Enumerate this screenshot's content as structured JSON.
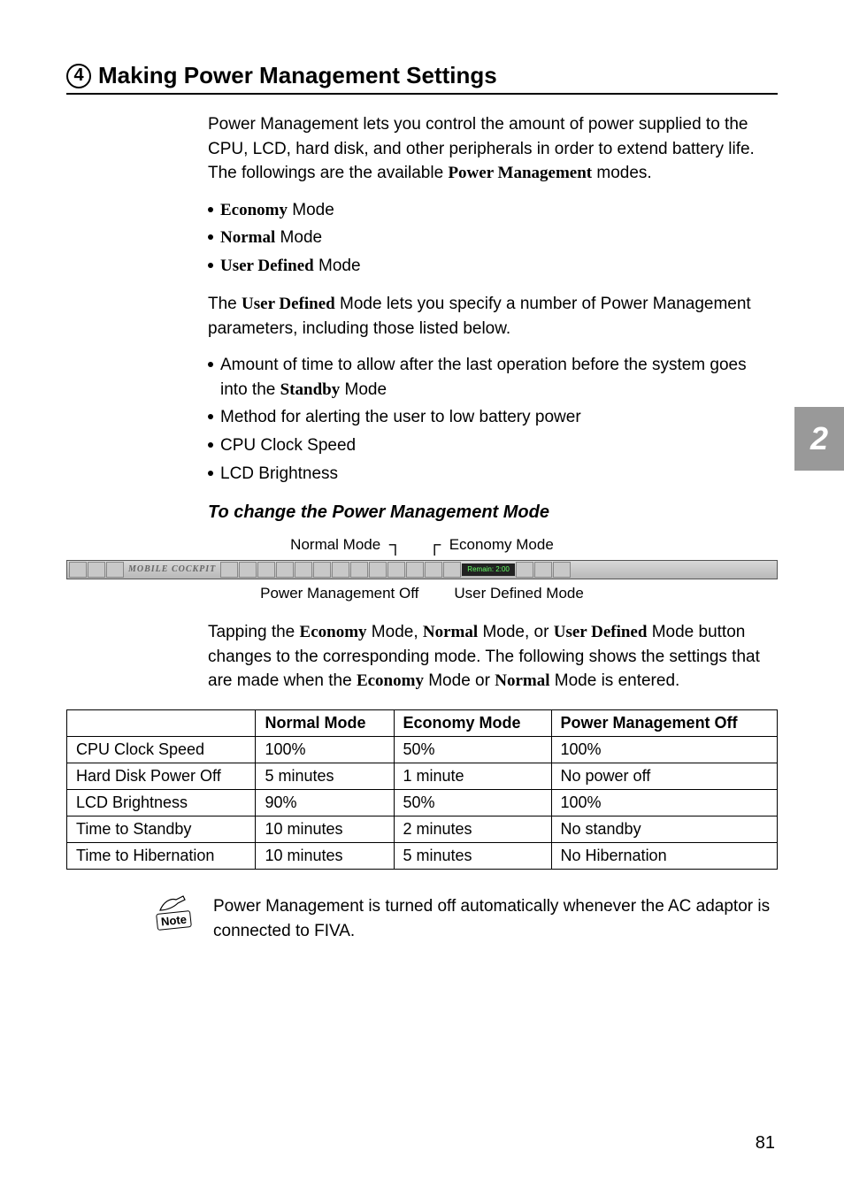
{
  "heading": {
    "num": "4",
    "title": "Making Power Management Settings"
  },
  "intro": {
    "pre": "Power Management lets you control the amount of power supplied to the CPU, LCD, hard disk, and other peripherals in order to extend battery life. The followings are the available ",
    "bold": "Power Management",
    "post": " modes."
  },
  "modes_list": [
    {
      "bold": "Economy",
      "rest": " Mode"
    },
    {
      "bold": "Normal",
      "rest": " Mode"
    },
    {
      "bold": "User Defined",
      "rest": " Mode"
    }
  ],
  "ud_intro": {
    "pre": "The ",
    "bold": "User Defined",
    "post": " Mode lets you specify a number of Power Management parameters, including those listed below."
  },
  "ud_list": {
    "i1a": "Amount of time to allow after the last operation before the system goes into the ",
    "i1b": "Standby",
    "i1c": " Mode",
    "i2": "Method for alerting the user to low battery power",
    "i3": "CPU Clock Speed",
    "i4": "LCD Brightness"
  },
  "sub_heading": "To change the Power Management Mode",
  "labels": {
    "normal": "Normal Mode",
    "economy": "Economy Mode",
    "pmoff": "Power Management Off",
    "userdef": "User Defined Mode"
  },
  "toolbar": {
    "brand": "MOBILE COCKPIT",
    "remain": "Remain: 2:00"
  },
  "tap_para": {
    "t1": "Tapping the ",
    "b1": "Economy",
    "t2": " Mode, ",
    "b2": "Normal",
    "t3": " Mode, or ",
    "b3": "User Defined",
    "t4": " Mode button changes to the corresponding mode. The following shows the settings that are made when the ",
    "b4": "Economy",
    "t5": " Mode or ",
    "b5": "Normal",
    "t6": " Mode is entered."
  },
  "table": {
    "headers": [
      "",
      "Normal Mode",
      "Economy Mode",
      "Power Management Off"
    ],
    "rows": [
      [
        "CPU Clock Speed",
        "100%",
        "50%",
        "100%"
      ],
      [
        "Hard Disk Power Off",
        "5 minutes",
        "1 minute",
        "No power off"
      ],
      [
        "LCD Brightness",
        "90%",
        "50%",
        "100%"
      ],
      [
        "Time to Standby",
        "10 minutes",
        "2 minutes",
        "No standby"
      ],
      [
        "Time to Hibernation",
        "10 minutes",
        "5 minutes",
        "No Hibernation"
      ]
    ]
  },
  "note": {
    "label": "Note",
    "text": "Power Management is turned off automatically whenever the AC adaptor is connected to FIVA."
  },
  "side_tab": "2",
  "page_num": "81"
}
